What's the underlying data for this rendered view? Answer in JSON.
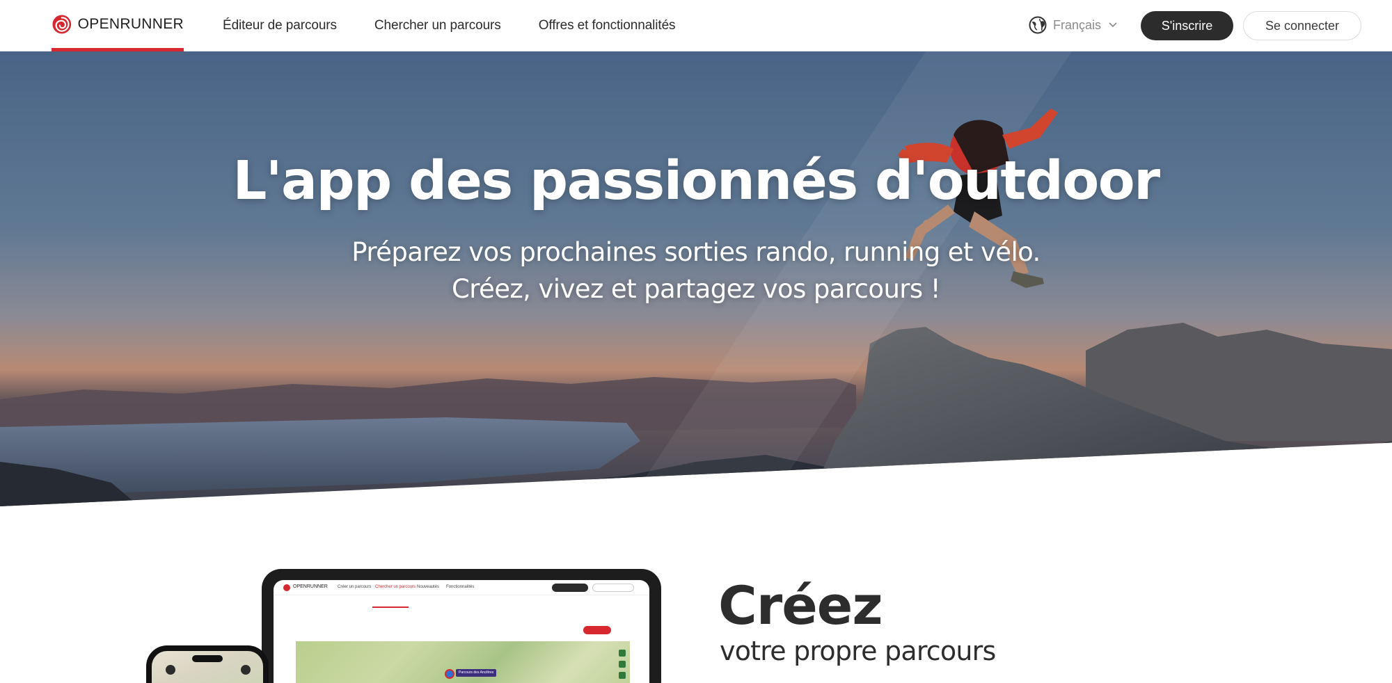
{
  "brand": {
    "name": "OPENRUNNER",
    "accent": "#d7272f"
  },
  "header": {
    "nav": [
      {
        "label": "Éditeur de parcours"
      },
      {
        "label": "Chercher un parcours"
      },
      {
        "label": "Offres et fonctionnalités"
      }
    ],
    "language": {
      "label": "Français",
      "icon": "globe-icon"
    },
    "signup_label": "S'inscrire",
    "login_label": "Se connecter"
  },
  "hero": {
    "title": "L'app des passionnés d'outdoor",
    "subtitle_line1": "Préparez vos prochaines sorties rando, running et vélo.",
    "subtitle_line2": "Créez, vivez et partagez vos parcours !"
  },
  "feature": {
    "title": "Créez",
    "subtitle": "votre propre parcours"
  },
  "mockup": {
    "logo": "OPENRUNNER",
    "nav": [
      "Créer un parcours",
      "Chercher un parcours",
      "Nouveautés",
      "Fonctionnalités"
    ],
    "map_label": "Parcours des Ancêtres"
  }
}
